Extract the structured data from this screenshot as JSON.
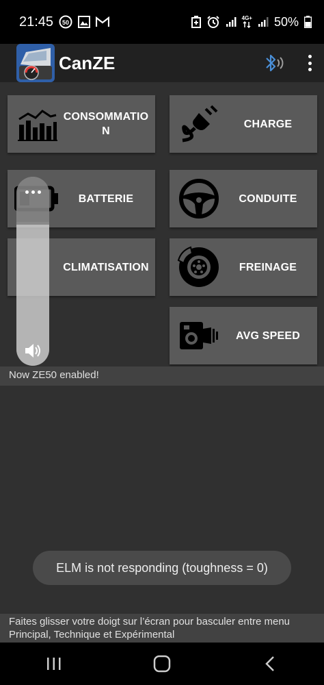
{
  "status_bar": {
    "time": "21:45",
    "battery_percent": "50%",
    "network": "4G+",
    "left_icons": [
      "speed-limit-50-icon",
      "gallery-icon",
      "gmail-icon"
    ],
    "right_icons": [
      "battery-saver-icon",
      "alarm-icon",
      "signal-icon",
      "4g-signal-icon",
      "signal-icon",
      "battery-icon"
    ]
  },
  "app_bar": {
    "title": "CanZE",
    "icons": [
      "canze-logo",
      "bluetooth-icon",
      "more-vert-icon"
    ],
    "bluetooth_color": "#4a90d9"
  },
  "tiles": [
    {
      "label": "CONSOMMATION",
      "icon": "consumption-chart-icon"
    },
    {
      "label": "CHARGE",
      "icon": "plug-icon"
    },
    {
      "label": "BATTERIE",
      "icon": "battery-icon"
    },
    {
      "label": "CONDUITE",
      "icon": "steering-wheel-icon"
    },
    {
      "label": "CLIMATISATION",
      "icon": "climate-icon"
    },
    {
      "label": "FREINAGE",
      "icon": "brake-disc-icon"
    },
    {
      "label": "AVG SPEED",
      "icon": "speed-camera-icon"
    }
  ],
  "notice": "Now ZE50 enabled!",
  "toast": "ELM is not responding (toughness = 0)",
  "footer_hint": "Faites glisser votre doigt sur l’écran pour basculer entre menu Principal, Technique et Expérimental",
  "volume_overlay": {
    "level_fraction": 0.76,
    "icons": [
      "more-icon",
      "speaker-icon"
    ]
  },
  "nav_bar": {
    "buttons": [
      "recent-apps-icon",
      "home-icon",
      "back-icon"
    ]
  },
  "colors": {
    "background": "#303030",
    "tile": "#5a5a5a",
    "app_bar": "#212121"
  }
}
